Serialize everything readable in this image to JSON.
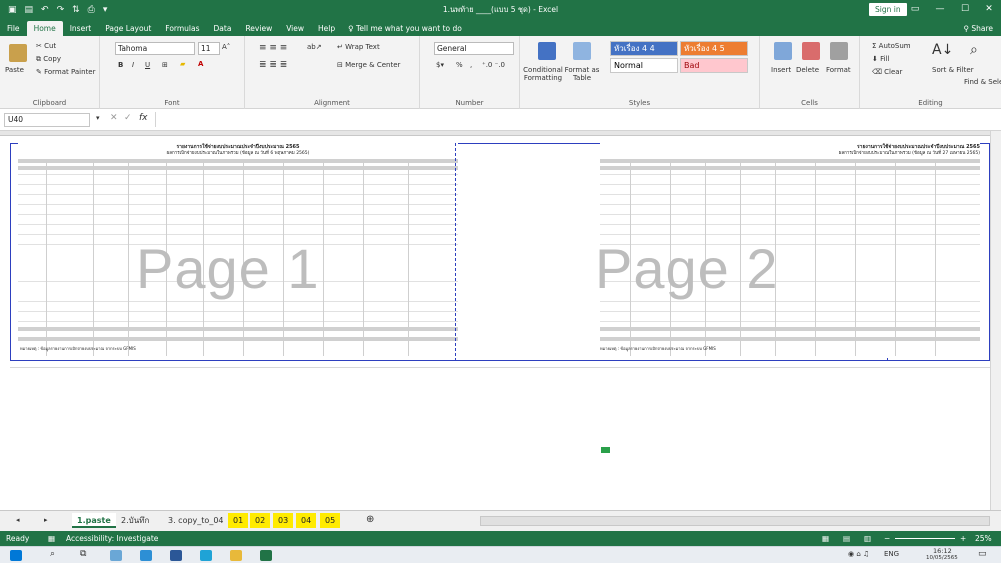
{
  "window": {
    "title": "1.นพท้าย ____(แบบ 5 ชุด) - Excel",
    "signin": "Sign in",
    "minimize": "—",
    "restore": "☐",
    "close": "✕"
  },
  "menu": {
    "tabs": [
      "File",
      "Home",
      "Insert",
      "Page Layout",
      "Formulas",
      "Data",
      "Review",
      "View",
      "Help"
    ],
    "active": "Home",
    "tell_me": "Tell me what you want to do",
    "share": "Share"
  },
  "ribbon": {
    "clipboard": {
      "label": "Clipboard",
      "paste": "Paste",
      "cut": "Cut",
      "copy": "Copy",
      "format_painter": "Format Painter"
    },
    "font": {
      "label": "Font",
      "name": "Tahoma",
      "size": "11",
      "bold": "B",
      "italic": "I",
      "underline": "U"
    },
    "alignment": {
      "label": "Alignment",
      "wrap_text": "Wrap Text",
      "merge_center": "Merge & Center"
    },
    "number": {
      "label": "Number",
      "format": "General",
      "percent": "%",
      "comma": ","
    },
    "styles": {
      "label": "Styles",
      "conditional": "Conditional Formatting",
      "format_as_table": "Format as Table",
      "cells": [
        {
          "text": "หัวเรื่อง 4 4",
          "bg": "#4472c4",
          "fg": "#ffffff"
        },
        {
          "text": "หัวเรื่อง 4 5",
          "bg": "#ed7d31",
          "fg": "#ffffff"
        },
        {
          "text": "Normal",
          "bg": "#ffffff",
          "fg": "#000000"
        },
        {
          "text": "Bad",
          "bg": "#ffc7ce",
          "fg": "#9c0006"
        }
      ]
    },
    "cells": {
      "label": "Cells",
      "insert": "Insert",
      "delete": "Delete",
      "format": "Format"
    },
    "editing": {
      "label": "Editing",
      "autosum": "AutoSum",
      "fill": "Fill",
      "clear": "Clear",
      "sort_filter": "Sort & Filter",
      "find_select": "Find & Select"
    }
  },
  "formula_bar": {
    "name_box": "U40",
    "fx": "fx",
    "value": ""
  },
  "sheet": {
    "page1": {
      "watermark": "Page 1",
      "title": "รายงานการใช้จ่ายงบประมาณประจำปีงบประมาณ 2565",
      "subtitle": "ผลการเบิกจ่ายงบประมาณในภาพรวม (ข้อมูล ณ วันที่ 6 พฤษภาคม 2565)"
    },
    "page2": {
      "watermark": "Page 2",
      "title": "รายงานการใช้จ่ายงบประมาณประจำปีงบประมาณ 2565",
      "subtitle": "ผลการเบิกจ่ายงบประมาณในภาพรวม (ข้อมูล ณ วันที่ 27 เมษายน 2565)"
    },
    "note": "หมายเหตุ : ข้อมูลรายงานการเบิกจ่ายงบประมาณ จากระบบ GFMIS"
  },
  "sheet_tabs": [
    {
      "label": "1.paste",
      "active": true,
      "yellow": false
    },
    {
      "label": "2.บันทึก",
      "active": false,
      "yellow": false
    },
    {
      "label": "3. copy_to_04",
      "active": false,
      "yellow": false
    },
    {
      "label": "01",
      "active": false,
      "yellow": true
    },
    {
      "label": "02",
      "active": false,
      "yellow": true
    },
    {
      "label": "03",
      "active": false,
      "yellow": true
    },
    {
      "label": "04",
      "active": false,
      "yellow": true
    },
    {
      "label": "05",
      "active": false,
      "yellow": true
    }
  ],
  "status": {
    "ready": "Ready",
    "accessibility": "Accessibility: Investigate",
    "zoom": "25%"
  },
  "taskbar": {
    "lang": "ENG",
    "time": "16:12",
    "date": "10/05/2565"
  }
}
